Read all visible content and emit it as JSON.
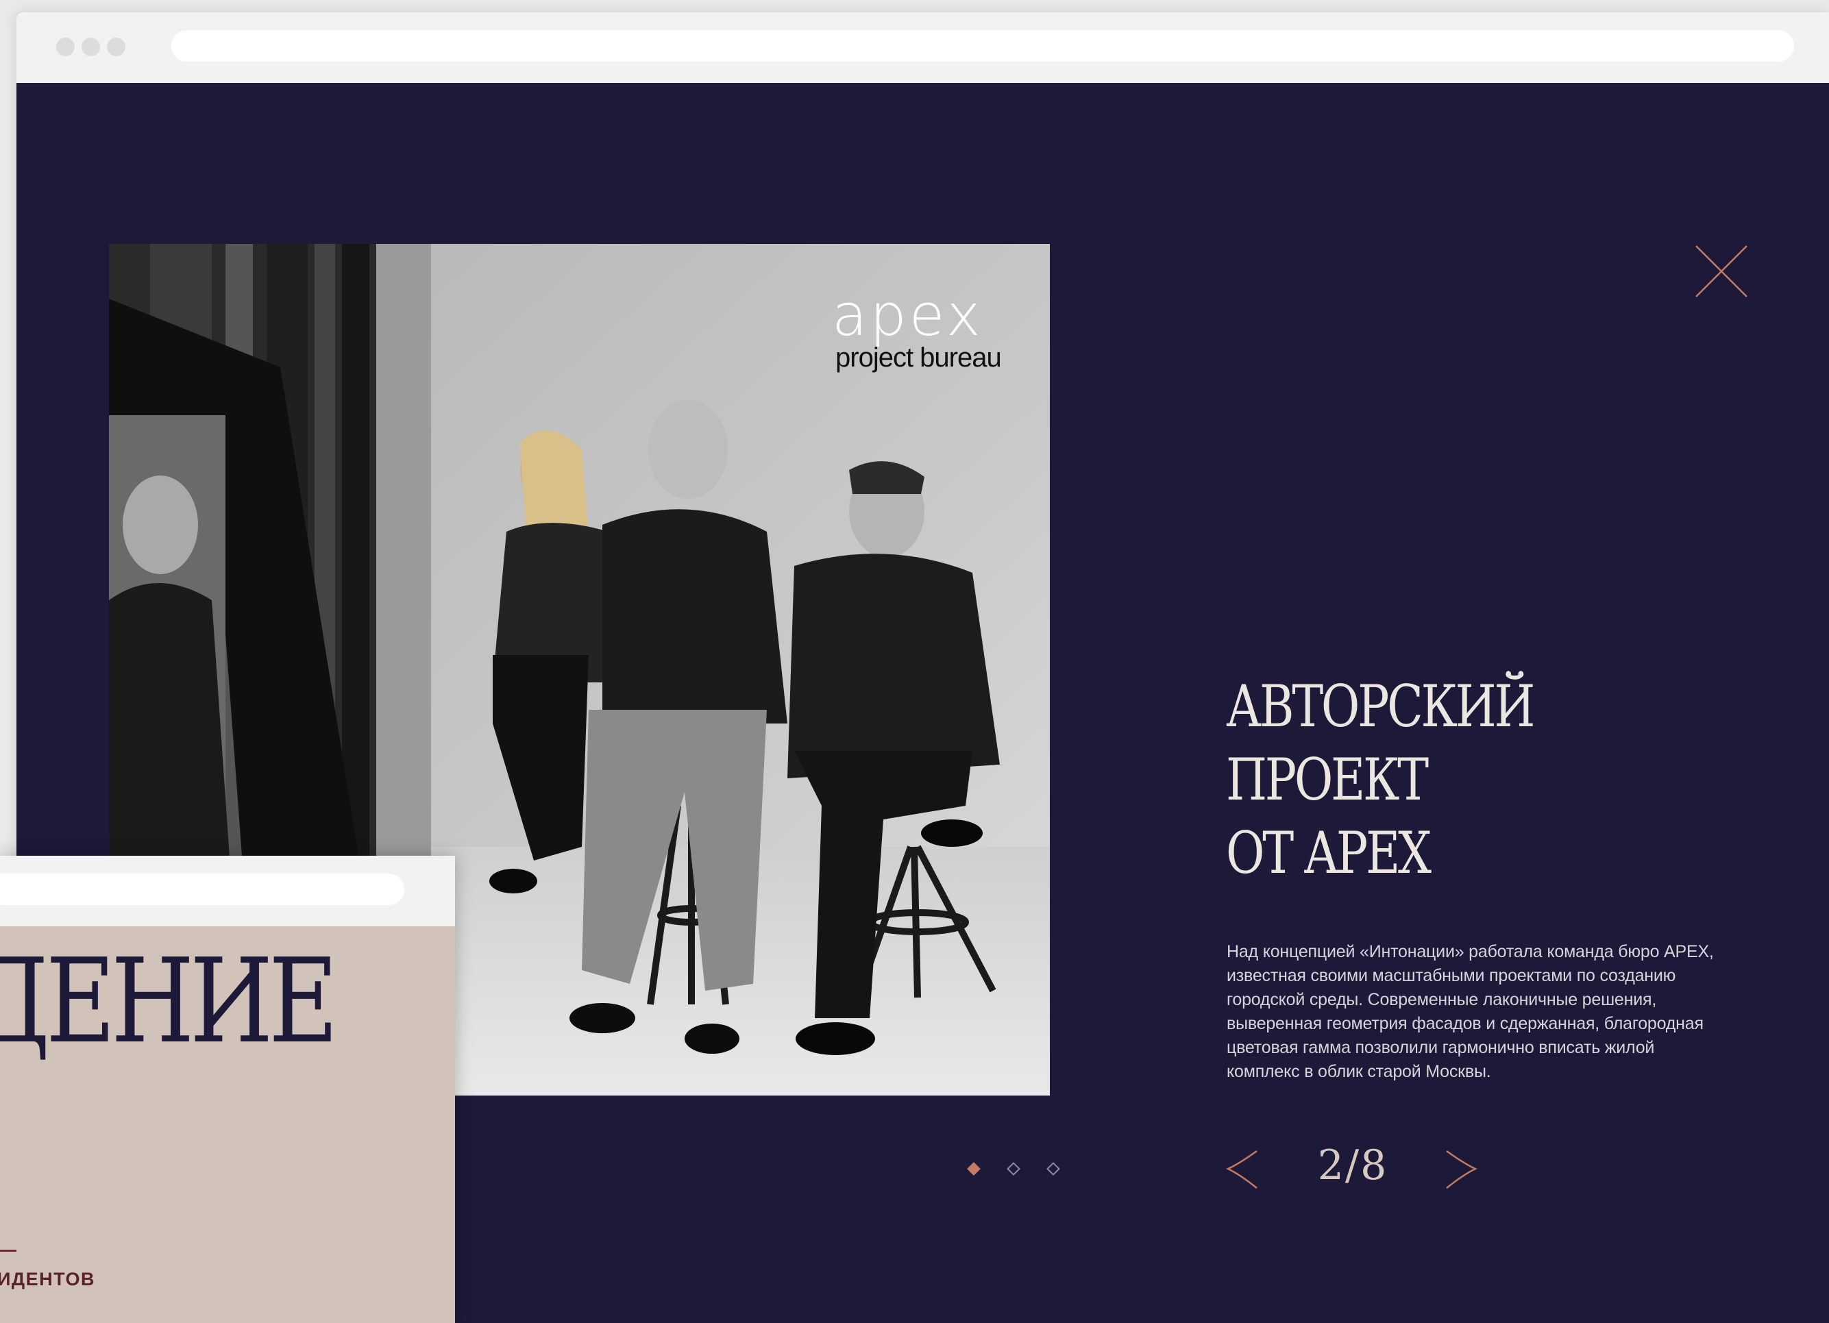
{
  "browser": {
    "window_controls": [
      "close-dot",
      "minimize-dot",
      "zoom-dot"
    ],
    "address_bar": ""
  },
  "photo": {
    "logo": {
      "word": "apex",
      "subtitle": "project bureau"
    },
    "description": "black and white group portrait of four people seated on stools"
  },
  "modal": {
    "heading_lines": [
      "АВТОРСКИЙ",
      "ПРОЕКТ",
      "ОТ APEX"
    ],
    "description": "Над концепцией «Интонации» работала команда бюро APEX, известная своими масштабными проектами по созданию городской среды. Современные лаконичные решения, выверенная геометрия фасадов и сдержанная, благородная цветовая гамма позволили гармонично вписать жилой комплекс в облик старой Москвы.",
    "counter": "2/8",
    "current_slide": 2,
    "total_slides": 8,
    "close_icon": "close-icon",
    "prev_icon": "chevron-left-icon",
    "next_icon": "chevron-right-icon"
  },
  "gallery_dots": {
    "count": 3,
    "active_index": 0
  },
  "background_window": {
    "big_text": "ДЕНИЕ",
    "small_text": "ИДЕНТОВ"
  },
  "colors": {
    "background": "#1c1a38",
    "accent": "#c47a63",
    "heading": "#ece6e1",
    "overlay_bg": "#d1c3ba"
  }
}
